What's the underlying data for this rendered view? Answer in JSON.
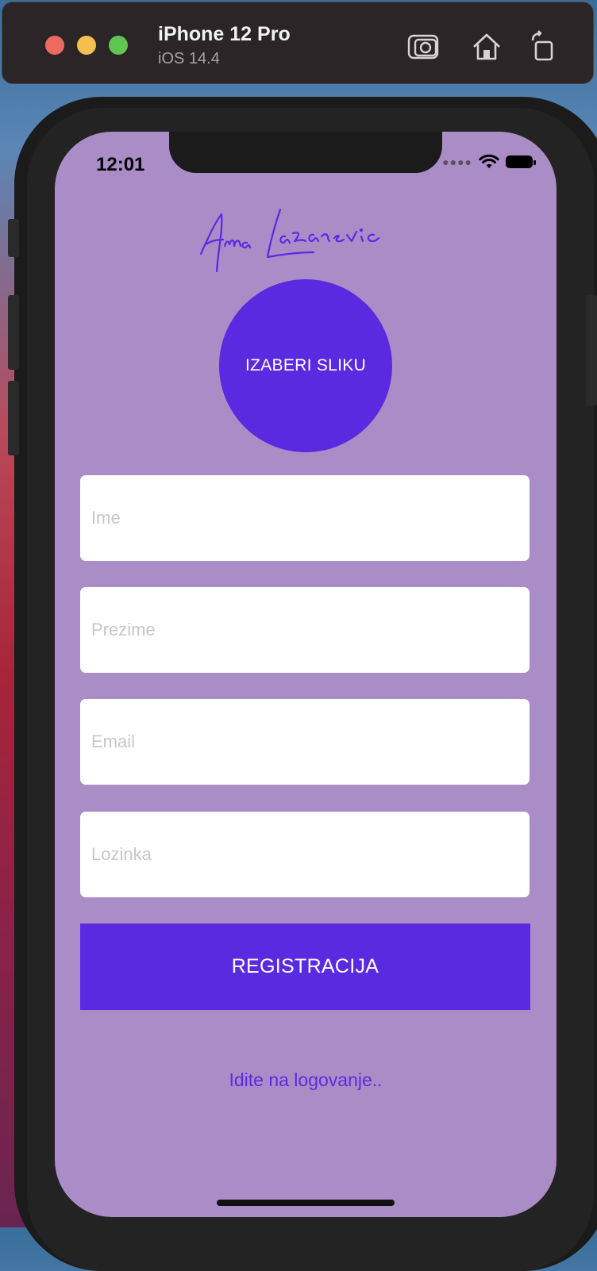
{
  "simulator": {
    "device": "iPhone 12 Pro",
    "os": "iOS 14.4",
    "icons": [
      "screenshot-icon",
      "home-icon",
      "rotate-icon"
    ]
  },
  "status_bar": {
    "time": "12:01",
    "icons": [
      "signal-dots-icon",
      "wifi-icon",
      "battery-icon"
    ]
  },
  "app": {
    "signature": "Anna Lazarevic",
    "avatar_button": "IZABERI SLIKU",
    "fields": [
      {
        "placeholder": "Ime",
        "value": ""
      },
      {
        "placeholder": "Prezime",
        "value": ""
      },
      {
        "placeholder": "Email",
        "value": ""
      },
      {
        "placeholder": "Lozinka",
        "value": ""
      }
    ],
    "register_button": "REGISTRACIJA",
    "login_link": "Idite na logovanje..",
    "colors": {
      "background": "#aa8cc7",
      "accent": "#5a2ae0"
    }
  }
}
